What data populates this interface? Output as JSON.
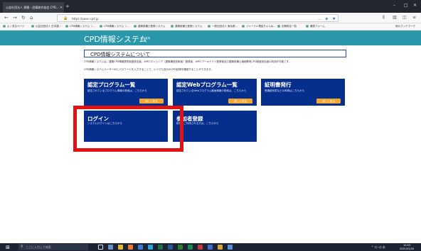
{
  "browser": {
    "tab_title": "公益社団法人 建築・設備総合協会 CPD...",
    "url": "https://paec-cpd.jp",
    "bookmarks": [
      "よく見るページ",
      "公益社団法人 日本建...",
      "CPD情報システム（...",
      "CPD情報システム（...",
      "建築設備士登録システム",
      "建築設備士登録システム",
      "一般社団法人 東京都...",
      "ジャーナル電話ちゃんね...",
      "初期設定一覧",
      "確認フォーム"
    ],
    "right_bookmark": "他のブックマーク"
  },
  "site": {
    "title": "CPD情報システム",
    "subtitle": "参加者用"
  },
  "section": {
    "title": "CPD情報システムについて",
    "desc_line1": "CPD情報システムは、建築CPD情報提供制度参加者、APECエンジニア（建築構造技術者）登録者、APECアーキテクト登録者及び建築設備士継続教育CPD制度参加者の利用が可能です。",
    "desc_line2": "CPD情報システムユーザーIDとパスワードを入力することで、いつでも自分のCPD記録を確認することができます。"
  },
  "cards": {
    "c1": {
      "title": "認定プログラム一覧",
      "desc": "認定されているプログラム情報の検索は、こちらから",
      "btn": "詳しく見る"
    },
    "c2": {
      "title": "認定Webプログラム一覧",
      "desc": "認定されているWebプログラム動画情報の検索は、こちらから",
      "btn": "詳しく見る"
    },
    "c3": {
      "title": "証明書発行",
      "desc": "受講証明書などの申請はこちらから",
      "btn": "詳しく見る"
    },
    "c4": {
      "title": "ログイン",
      "desc": "システムログインはこちらから"
    },
    "c5": {
      "title": "参加者登録",
      "desc": "新規にご利用される方は、こちらから"
    }
  },
  "taskbar": {
    "search_placeholder": "ここに入力して検索",
    "time": "10:03",
    "date": "2021/01/20",
    "tray": "^ 口 ◁) あ"
  }
}
